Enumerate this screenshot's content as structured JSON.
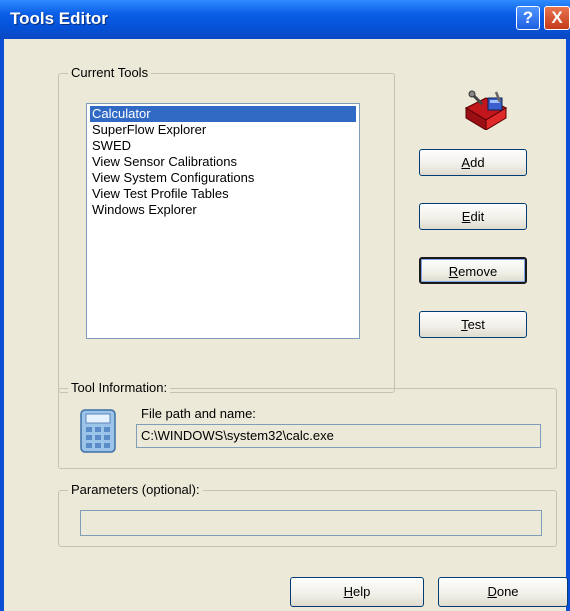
{
  "window": {
    "title": "Tools Editor",
    "help_glyph": "?",
    "close_glyph": "X"
  },
  "current_tools": {
    "legend": "Current Tools",
    "items": [
      "Calculator",
      "SuperFlow Explorer",
      "SWED",
      "View Sensor Calibrations",
      "View System Configurations",
      "View Test Profile Tables",
      "Windows Explorer"
    ],
    "selected_index": 0
  },
  "buttons": {
    "add": {
      "accel": "A",
      "rest": "dd"
    },
    "edit": {
      "accel": "E",
      "rest": "dit"
    },
    "remove": {
      "accel": "R",
      "rest": "emove"
    },
    "test": {
      "accel": "T",
      "rest": "est"
    },
    "help": {
      "accel": "H",
      "rest": "elp"
    },
    "done": {
      "accel": "D",
      "rest": "one"
    }
  },
  "tool_information": {
    "legend": "Tool Information:",
    "path_label": "File path and name:",
    "path_value": "C:\\WINDOWS\\system32\\calc.exe"
  },
  "parameters": {
    "legend": "Parameters (optional):",
    "value": ""
  },
  "icons": {
    "tools": "toolbox-icon",
    "calculator": "calculator-icon"
  },
  "colors": {
    "titlebar": "#0b5ee8",
    "selection": "#316ac5",
    "dialog_bg": "#ece9d8"
  }
}
